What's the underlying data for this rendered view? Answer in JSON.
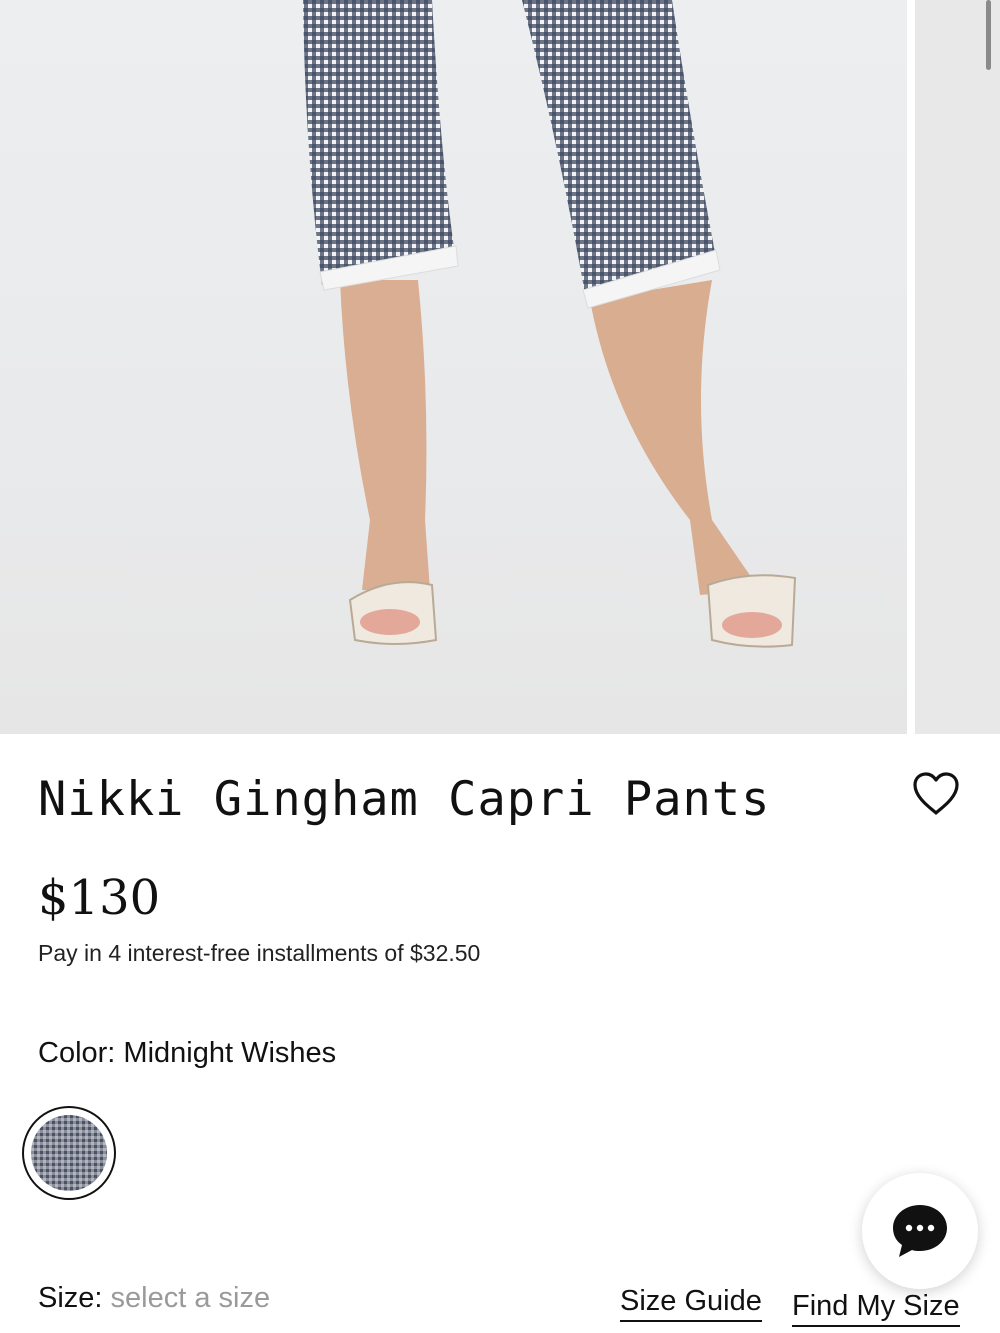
{
  "product": {
    "title": "Nikki Gingham Capri Pants",
    "price": "$130",
    "installments": "Pay in 4 interest-free installments of $32.50",
    "color": {
      "label": "Color:",
      "value": "Midnight Wishes",
      "swatch_color": "#4a5264"
    },
    "size": {
      "label": "Size:",
      "placeholder": "select a size"
    },
    "size_guide_label": "Size Guide",
    "find_my_size_label": "Find My Size"
  },
  "icons": {
    "wishlist": "heart-icon",
    "chat": "chat-bubble-icon"
  },
  "colors": {
    "text": "#111111",
    "muted": "#9a9a9a",
    "gingham": "#3f4a63",
    "background": "#ffffff"
  }
}
